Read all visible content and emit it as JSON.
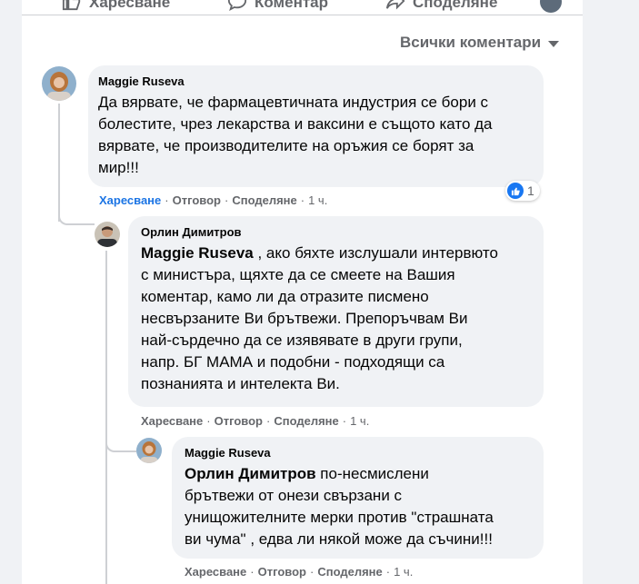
{
  "action_bar": {
    "like": "Харесване",
    "comment": "Коментар",
    "share": "Споделяне"
  },
  "sort": {
    "label": "Всички коментари"
  },
  "comments": [
    {
      "author": "Maggie Ruseva",
      "lines": [
        "Да вярвате, че фармацевтичната индустрия се бори с",
        "болестите, чрез лекарства и ваксини е същото като да",
        "вярвате, че производителите на оръжия се борят за",
        "мир!!!"
      ],
      "actions": {
        "like": "Харесване",
        "reply": "Отговор",
        "share": "Споделяне",
        "time": "1 ч."
      },
      "reaction_count": "1"
    },
    {
      "author": "Орлин Димитров",
      "mention": "Maggie Ruseva",
      "lines": [
        " , ако бяхте изслушали интервюто",
        "с министъра, щяхте да се смеете на Вашия",
        "коментар, камо ли да отразите писмено",
        "несвързаните Ви брътвежи. Препоръчвам Ви",
        "най-сърдечно да се изявявате в други групи,",
        "напр. БГ МАМА и подобни - подходящи са",
        "познанията и интелекта Ви."
      ],
      "actions": {
        "like": "Харесване",
        "reply": "Отговор",
        "share": "Споделяне",
        "time": "1 ч."
      }
    },
    {
      "author": "Maggie Ruseva",
      "mention": "Орлин Димитров",
      "lines": [
        " по-несмислени",
        "брътвежи от онези свързани с",
        "унищожителните мерки против \"страшната",
        "ви чума\" , едва ли някой може да съчини!!!"
      ],
      "actions": {
        "like": "Харесване",
        "reply": "Отговор",
        "share": "Споделяне",
        "time": "1 ч."
      }
    }
  ],
  "icons": {
    "like": "thumbs-up-icon",
    "comment": "speech-bubble-icon",
    "share": "share-arrow-icon",
    "sort": "caret-down-icon",
    "reaction": "like-reaction-icon"
  },
  "colors": {
    "page_bg": "#f0f2f5",
    "bubble_bg": "#f0f2f5",
    "secondary_text": "#65676b",
    "link_blue": "#1b74e4",
    "reaction_blue": "#1877f2"
  }
}
